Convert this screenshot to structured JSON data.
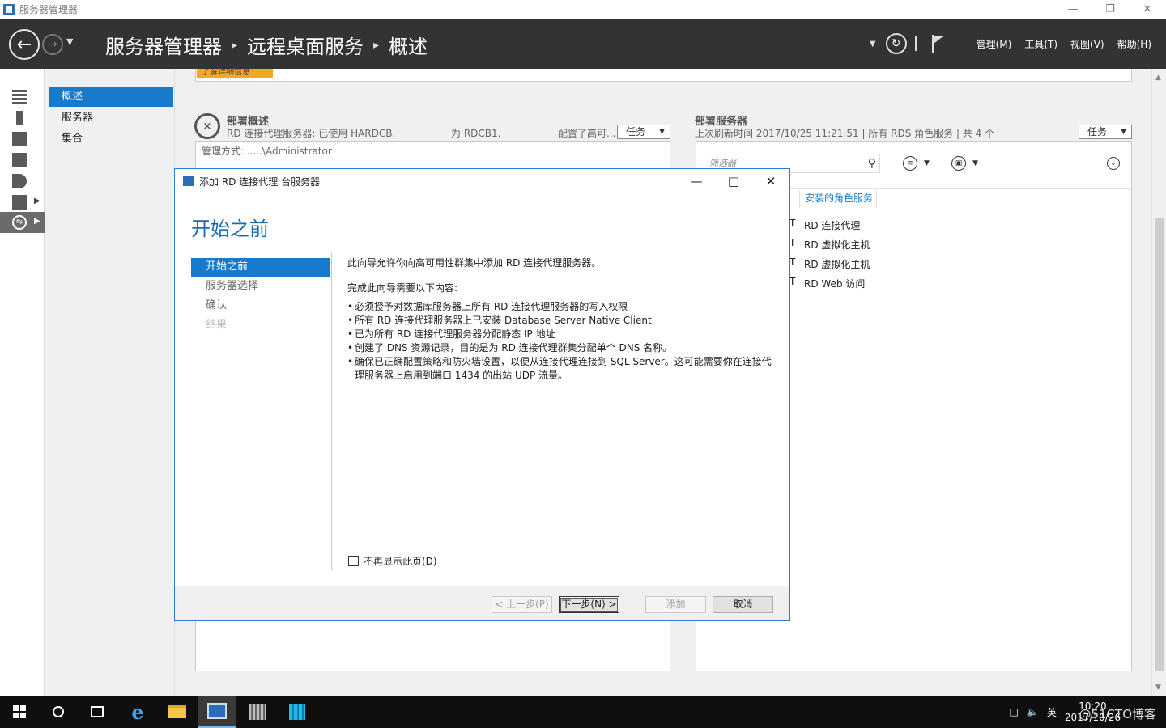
{
  "window": {
    "title": "服务器管理器",
    "controls": [
      "—",
      "❐",
      "✕"
    ]
  },
  "header": {
    "breadcrumb": [
      "服务器管理器",
      "远程桌面服务",
      "概述"
    ],
    "menus": [
      "管理(M)",
      "工具(T)",
      "视图(V)",
      "帮助(H)"
    ]
  },
  "sidebar": {
    "items": [
      {
        "label": "概述",
        "selected": true
      },
      {
        "label": "服务器",
        "selected": false
      },
      {
        "label": "集合",
        "selected": false
      }
    ]
  },
  "banner": {
    "text": "了解详细信息"
  },
  "deployment_overview": {
    "title": "部署概述",
    "subtitle": "RD 连接代理服务器: 已使用 HARDCB.",
    "subtitle_mid": "为 RDCB1.",
    "subtitle_end": "配置了高可...",
    "tasks_label": "任务",
    "admin_line": "管理方式: .....\\Administrator"
  },
  "deployment_servers": {
    "title": "部署服务器",
    "subtitle": "上次刷新时间 2017/10/25 11:21:51 | 所有 RDS 角色服务 | 共 4 个",
    "tasks_label": "任务",
    "filter_placeholder": "筛选器",
    "column_header": "安装的角色服务",
    "roles": [
      "RD 连接代理",
      "RD 虚拟化主机",
      "RD 虚拟化主机",
      "RD Web 访问"
    ]
  },
  "dialog": {
    "title": "添加 RD 连接代理 台服务器",
    "heading": "开始之前",
    "steps": [
      {
        "label": "开始之前",
        "state": "selected"
      },
      {
        "label": "服务器选择",
        "state": "normal"
      },
      {
        "label": "确认",
        "state": "normal"
      },
      {
        "label": "结果",
        "state": "disabled"
      }
    ],
    "intro": "此向导允许你向高可用性群集中添加 RD 连接代理服务器。",
    "requirements_title": "完成此向导需要以下内容:",
    "requirements": [
      "必须授予对数据库服务器上所有 RD 连接代理服务器的写入权限",
      "所有 RD 连接代理服务器上已安装 Database Server Native Client",
      "已为所有 RD 连接代理服务器分配静态 IP 地址",
      "创建了 DNS 资源记录，目的是为 RD 连接代理群集分配单个 DNS 名称。",
      "确保已正确配置策略和防火墙设置，以便从连接代理连接到 SQL Server。这可能需要你在连接代理服务器上启用到端口 1434 的出站 UDP 流量。"
    ],
    "checkbox_label": "不再显示此页(D)",
    "checkbox_checked": false,
    "buttons": {
      "prev": "< 上一步(P)",
      "next": "下一步(N) >",
      "add": "添加",
      "cancel": "取消"
    }
  },
  "taskbar": {
    "tray": {
      "ime": "英",
      "time": "10:20",
      "date": "2017/10/26"
    },
    "watermark": "@51CTO博客"
  }
}
